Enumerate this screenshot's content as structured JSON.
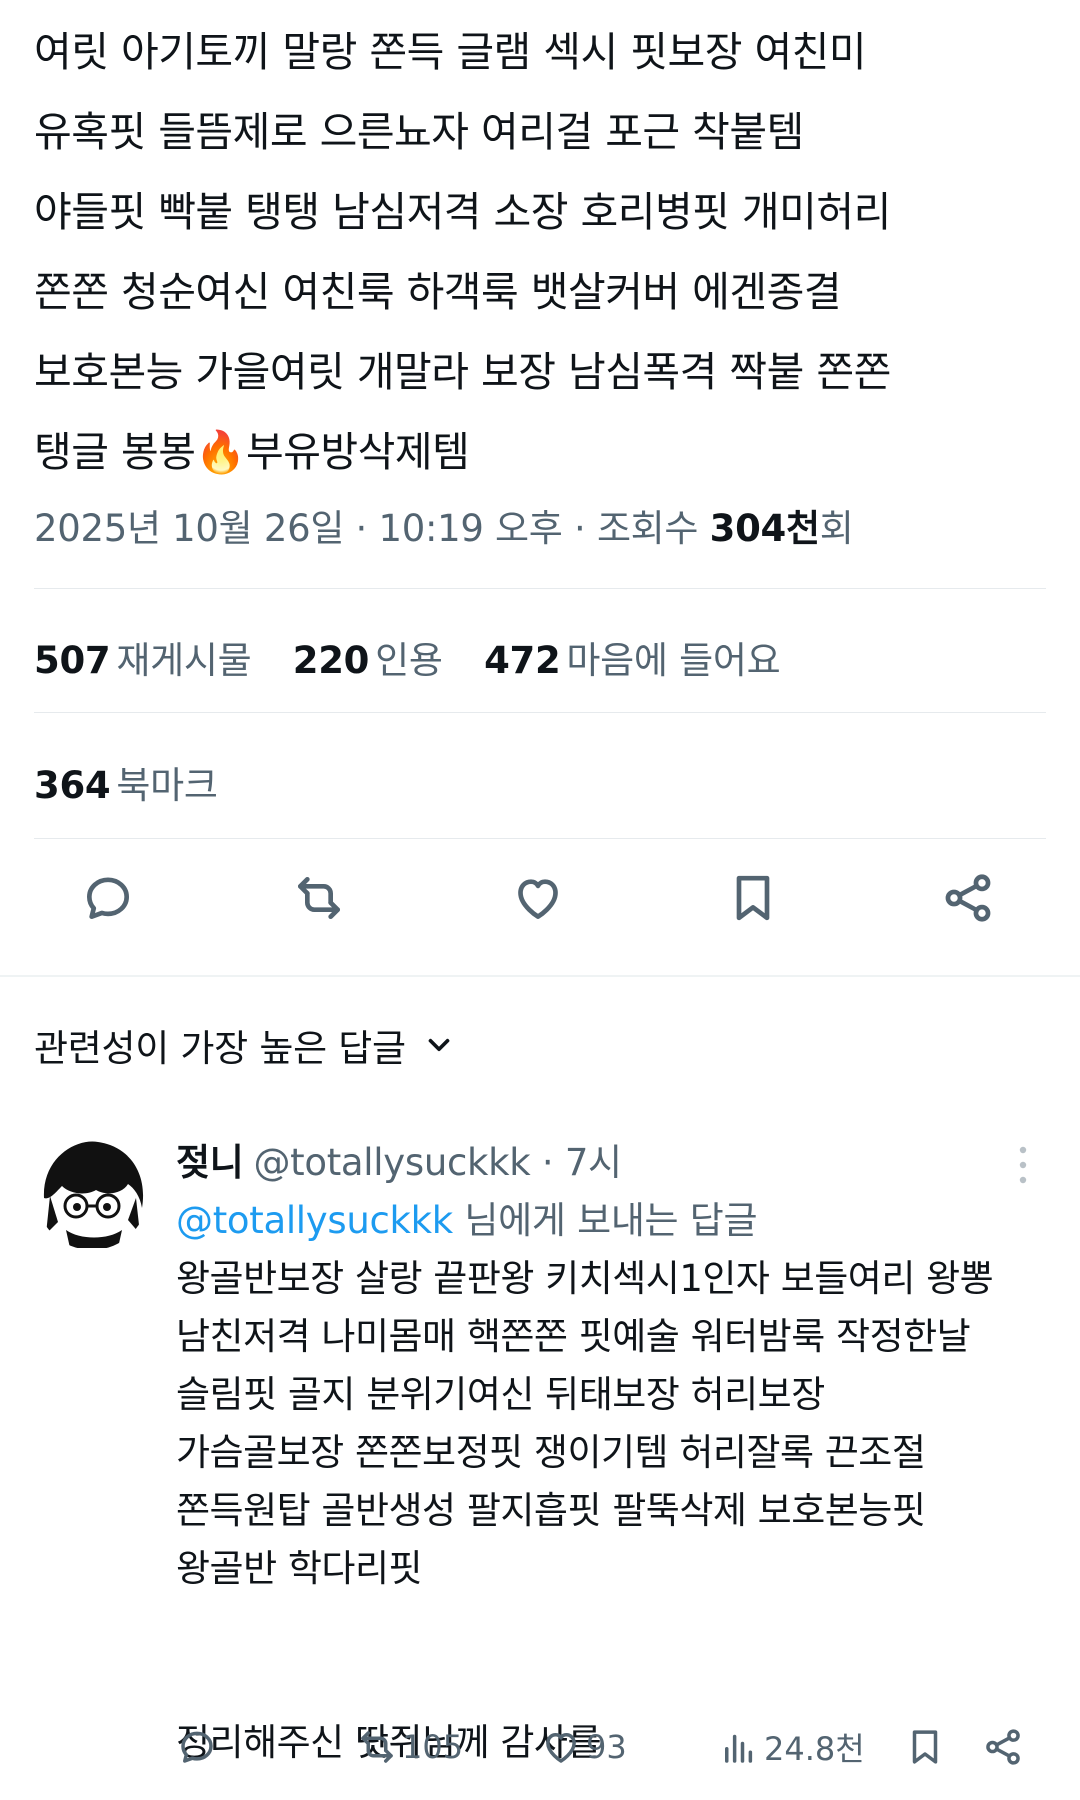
{
  "post": {
    "lines": [
      "여릿 아기토끼 말랑 쫀득 글램 섹시 핏보장 여친미",
      "유혹핏 들뜸제로 으른뇨자 여리걸 포근 착붙템",
      "야들핏 빡붙 탱탱 남심저격 소장 호리병핏 개미허리",
      "쫀쫀 청순여신 여친룩 하객룩 뱃살커버 에겐종결",
      "보호본능 가을여릿 개말라 보장 남심폭격 짝붙 쫀쫀",
      "탱글 봉봉",
      "부유방삭제템"
    ],
    "emoji": "🔥",
    "date": "2025년 10월 26일",
    "separator": " · ",
    "time": "10:19 오후",
    "views_label": "조회수 ",
    "views_value": "304천",
    "views_suffix": "회"
  },
  "stats": {
    "reposts": {
      "num": "507",
      "label": "재게시물"
    },
    "quotes": {
      "num": "220",
      "label": "인용"
    },
    "likes": {
      "num": "472",
      "label": "마음에 들어요"
    },
    "bookmarks": {
      "num": "364",
      "label": "북마크"
    }
  },
  "actions": [
    "reply-icon",
    "repost-icon",
    "like-icon",
    "bookmark-icon",
    "share-icon"
  ],
  "sort": {
    "label": "관련성이 가장 높은 답글"
  },
  "reply": {
    "name": "젖니",
    "handle": "@totallysuckkk",
    "dot": " · ",
    "time": "7시",
    "reply_to_mention": "@totallysuckkk",
    "reply_to_suffix": " 님에게 보내는 답글",
    "lines": [
      "왕골반보장 살랑 끝판왕 키치섹시1인자 보들여리 왕뽕",
      "남친저격 나미몸매 핵쫀쫀 핏예술 워터밤룩 작정한날",
      "슬림핏 골지 분위기여신 뒤태보장 허리보장",
      "가슴골보장 쫀쫀보정핏 쟁이기템 허리잘록 끈조절",
      "쫀득원탑 골반생성 팔지흡핏 팔뚝삭제 보호본능핏",
      "왕골반 학다리핏",
      "정리해주신 땃쥐님께 감사를"
    ],
    "counts": {
      "reposts": "105",
      "likes": "93",
      "views": "24.8천"
    }
  },
  "colors": {
    "text": "#0f1419",
    "secondary": "#536471",
    "link": "#1d9bf0",
    "divider": "#e6eaed"
  }
}
